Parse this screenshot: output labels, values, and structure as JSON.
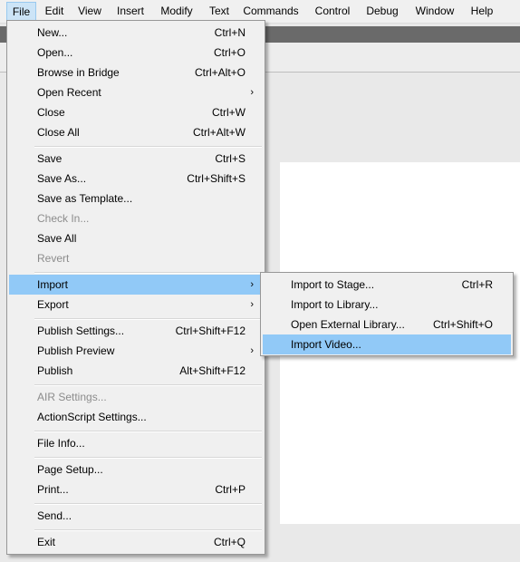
{
  "menubar": {
    "items": [
      {
        "label": "File"
      },
      {
        "label": "Edit"
      },
      {
        "label": "View"
      },
      {
        "label": "Insert"
      },
      {
        "label": "Modify"
      },
      {
        "label": "Text"
      },
      {
        "label": "Commands"
      },
      {
        "label": "Control"
      },
      {
        "label": "Debug"
      },
      {
        "label": "Window"
      },
      {
        "label": "Help"
      }
    ]
  },
  "file_menu": {
    "items": [
      {
        "label": "New...",
        "shortcut": "Ctrl+N"
      },
      {
        "label": "Open...",
        "shortcut": "Ctrl+O"
      },
      {
        "label": "Browse in Bridge",
        "shortcut": "Ctrl+Alt+O"
      },
      {
        "label": "Open Recent",
        "shortcut": ""
      },
      {
        "label": "Close",
        "shortcut": "Ctrl+W"
      },
      {
        "label": "Close All",
        "shortcut": "Ctrl+Alt+W"
      },
      {
        "label": "Save",
        "shortcut": "Ctrl+S"
      },
      {
        "label": "Save As...",
        "shortcut": "Ctrl+Shift+S"
      },
      {
        "label": "Save as Template...",
        "shortcut": ""
      },
      {
        "label": "Check In...",
        "shortcut": ""
      },
      {
        "label": "Save All",
        "shortcut": ""
      },
      {
        "label": "Revert",
        "shortcut": ""
      },
      {
        "label": "Import",
        "shortcut": ""
      },
      {
        "label": "Export",
        "shortcut": ""
      },
      {
        "label": "Publish Settings...",
        "shortcut": "Ctrl+Shift+F12"
      },
      {
        "label": "Publish Preview",
        "shortcut": ""
      },
      {
        "label": "Publish",
        "shortcut": "Alt+Shift+F12"
      },
      {
        "label": "AIR Settings...",
        "shortcut": ""
      },
      {
        "label": "ActionScript Settings...",
        "shortcut": ""
      },
      {
        "label": "File Info...",
        "shortcut": ""
      },
      {
        "label": "Page Setup...",
        "shortcut": ""
      },
      {
        "label": "Print...",
        "shortcut": "Ctrl+P"
      },
      {
        "label": "Send...",
        "shortcut": ""
      },
      {
        "label": "Exit",
        "shortcut": "Ctrl+Q"
      }
    ]
  },
  "import_submenu": {
    "items": [
      {
        "label": "Import to Stage...",
        "shortcut": "Ctrl+R"
      },
      {
        "label": "Import to Library...",
        "shortcut": ""
      },
      {
        "label": "Open External Library...",
        "shortcut": "Ctrl+Shift+O"
      },
      {
        "label": "Import Video...",
        "shortcut": ""
      }
    ]
  },
  "colors": {
    "highlight": "#91c9f7",
    "menu_bg": "#f0f0f0",
    "disabled_text": "#8c8c8c"
  },
  "icons": {
    "submenu_arrow": "chevron-right-icon"
  }
}
